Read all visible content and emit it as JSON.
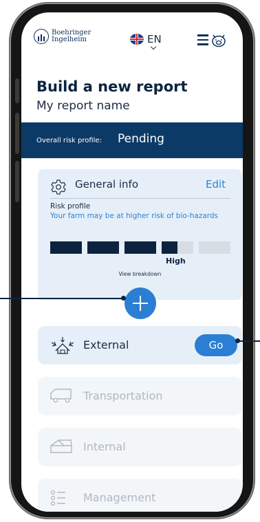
{
  "brand": {
    "name_line1": "Boehringer",
    "name_line2": "Ingelheim"
  },
  "header": {
    "language": "EN"
  },
  "page": {
    "title": "Build a new report",
    "report_name": "My report name"
  },
  "risk": {
    "label": "Overall risk profile:",
    "value": "Pending"
  },
  "general_info": {
    "title": "General info",
    "edit_label": "Edit",
    "risk_profile_label": "Risk profile",
    "message": "Your farm may be at higher risk of bio-hazards",
    "level": "High",
    "level_filled_segments": 3.5,
    "total_segments": 5,
    "view_breakdown": "View breakdown"
  },
  "sections": [
    {
      "label": "External",
      "icon": "biosecurity-external-icon",
      "active": true,
      "go_label": "Go"
    },
    {
      "label": "Transportation",
      "icon": "truck-icon",
      "active": false
    },
    {
      "label": "Internal",
      "icon": "barn-icon",
      "active": false
    },
    {
      "label": "Management",
      "icon": "checklist-icon",
      "active": false
    }
  ],
  "colors": {
    "navy": "#0c2340",
    "accent": "#2a7fd4",
    "card": "#e6eff8"
  }
}
